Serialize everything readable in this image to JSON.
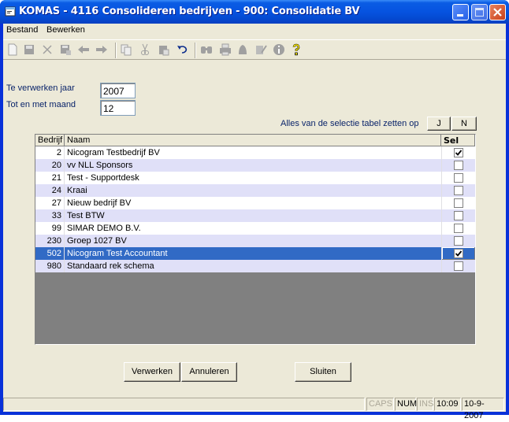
{
  "window": {
    "title": "KOMAS - 4116 Consolideren bedrijven - 900: Consolidatie BV",
    "controls": [
      "minimize",
      "maximize",
      "close"
    ]
  },
  "menu": {
    "items": [
      {
        "label": "Bestand"
      },
      {
        "label": "Bewerken"
      }
    ]
  },
  "toolbar": {
    "icons": [
      "new-icon",
      "save-icon",
      "delete-icon",
      "save-as-icon",
      "back-icon",
      "forward-icon",
      "copy-icon",
      "cut-icon",
      "paste-icon",
      "undo-icon",
      "find-icon",
      "print-icon",
      "bell-icon",
      "edit-icon",
      "info-icon",
      "help-icon"
    ]
  },
  "form": {
    "year_label": "Te verwerken jaar",
    "year_value": "2007",
    "month_label": "Tot en met maand",
    "month_value": "12",
    "select_all_label": "Alles van de selectie tabel zetten op",
    "btn_j": "J",
    "btn_n": "N"
  },
  "table": {
    "columns": [
      "Bedrijf",
      "Naam",
      "Sel"
    ],
    "rows": [
      {
        "bedrijf": "2",
        "naam": "Nicogram Testbedrijf BV",
        "sel": true
      },
      {
        "bedrijf": "20",
        "naam": "vv NLL Sponsors",
        "sel": false
      },
      {
        "bedrijf": "21",
        "naam": "Test - Supportdesk",
        "sel": false
      },
      {
        "bedrijf": "24",
        "naam": "Kraai",
        "sel": false
      },
      {
        "bedrijf": "27",
        "naam": "Nieuw bedrijf BV",
        "sel": false
      },
      {
        "bedrijf": "33",
        "naam": "Test BTW",
        "sel": false
      },
      {
        "bedrijf": "99",
        "naam": "SIMAR DEMO B.V.",
        "sel": false
      },
      {
        "bedrijf": "230",
        "naam": "Groep 1027 BV",
        "sel": false
      },
      {
        "bedrijf": "502",
        "naam": "Nicogram Test Accountant",
        "sel": true,
        "selected": true
      },
      {
        "bedrijf": "980",
        "naam": "Standaard rek schema",
        "sel": false
      }
    ],
    "row_colors": {
      "even": "#ffffff",
      "odd": "#e0e0f8",
      "selected": "#316ac5"
    }
  },
  "buttons": {
    "verwerken": "Verwerken",
    "annuleren": "Annuleren",
    "sluiten": "Sluiten"
  },
  "status": {
    "caps": "CAPS",
    "num": "NUM",
    "ins": "INS",
    "time": "10:09",
    "date": "10-9-2007"
  }
}
